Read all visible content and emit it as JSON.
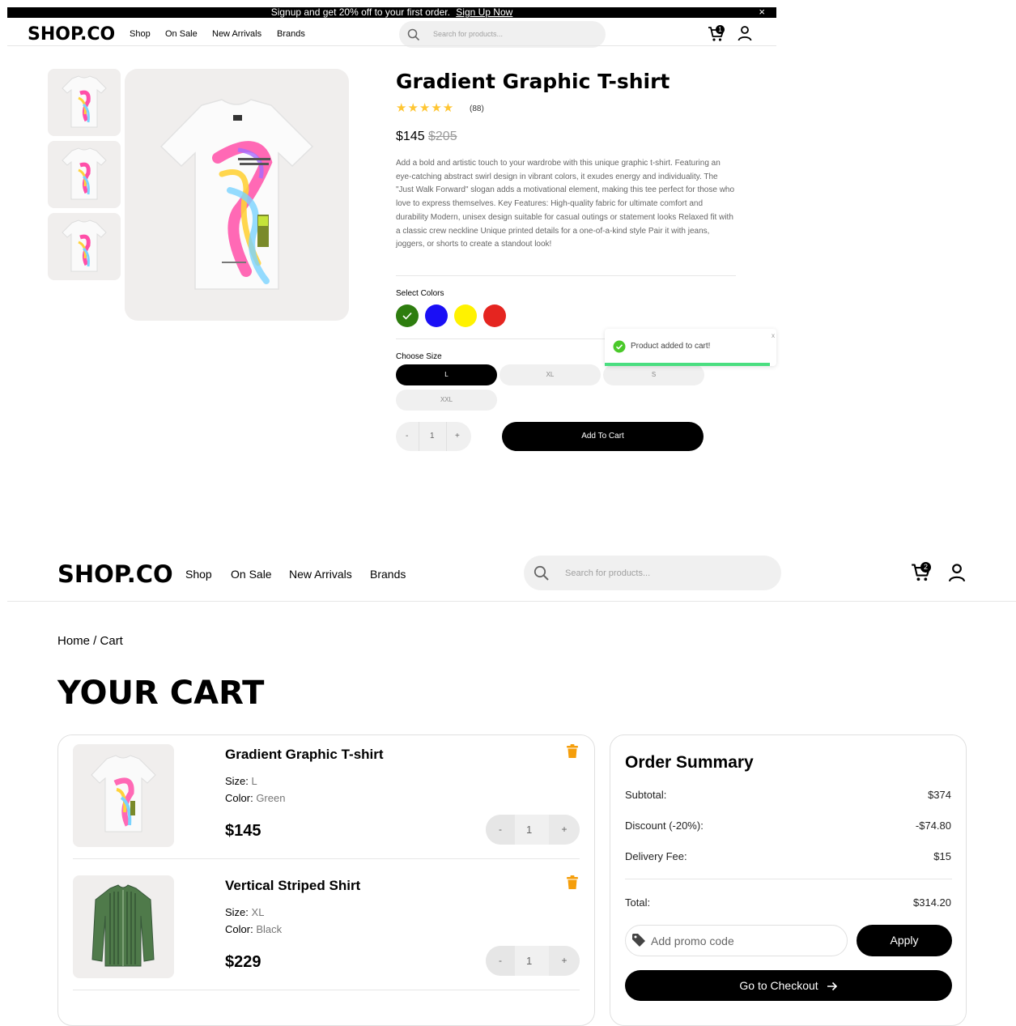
{
  "announcement": {
    "text": "Signup and get 20% off to your first order.",
    "link": "Sign Up Now",
    "close": "×"
  },
  "header": {
    "logo": "SHOP.CO",
    "nav": [
      "Shop",
      "On Sale",
      "New Arrivals",
      "Brands"
    ],
    "search_placeholder": "Search for products...",
    "cart_count_top": "1",
    "cart_count_bottom": "2"
  },
  "product": {
    "name": "Gradient Graphic T-shirt",
    "stars": "★★★★★",
    "reviews": "(88)",
    "price": "$145",
    "old_price": "$205",
    "description": "Add a bold and artistic touch to your wardrobe with this unique graphic t-shirt. Featuring an eye-catching abstract swirl design in vibrant colors, it exudes energy and individuality. The \"Just Walk Forward\" slogan adds a motivational element, making this tee perfect for those who love to express themselves. Key Features: High-quality fabric for ultimate comfort and durability Modern, unisex design suitable for casual outings or statement looks Relaxed fit with a classic crew neckline Unique printed details for a one-of-a-kind style Pair it with jeans, joggers, or shorts to create a standout look!",
    "colors_label": "Select Colors",
    "colors": [
      "#2e7d0f",
      "#1a0ff5",
      "#fff200",
      "#e52520"
    ],
    "size_label": "Choose Size",
    "sizes": [
      "L",
      "XL",
      "S",
      "XXL"
    ],
    "qty_minus": "-",
    "qty": "1",
    "qty_plus": "+",
    "add_to_cart": "Add To Cart"
  },
  "toast": {
    "message": "Product added to cart!",
    "close": "x"
  },
  "cart": {
    "breadcrumb": "Home / Cart",
    "title": "YOUR CART",
    "size_label": "Size:",
    "color_label": "Color:",
    "items": [
      {
        "name": "Gradient Graphic T-shirt",
        "size": "L",
        "color": "Green",
        "price": "$145",
        "qty": "1"
      },
      {
        "name": "Vertical Striped Shirt",
        "size": "XL",
        "color": "Black",
        "price": "$229",
        "qty": "1"
      }
    ],
    "qty_minus": "-",
    "qty_plus": "+"
  },
  "summary": {
    "title": "Order Summary",
    "subtotal_label": "Subtotal:",
    "subtotal": "$374",
    "discount_label": "Discount (-20%):",
    "discount": "-$74.80",
    "delivery_label": "Delivery Fee:",
    "delivery": "$15",
    "total_label": "Total:",
    "total": "$314.20",
    "promo_placeholder": "Add promo code",
    "apply": "Apply",
    "checkout": "Go to Checkout"
  }
}
